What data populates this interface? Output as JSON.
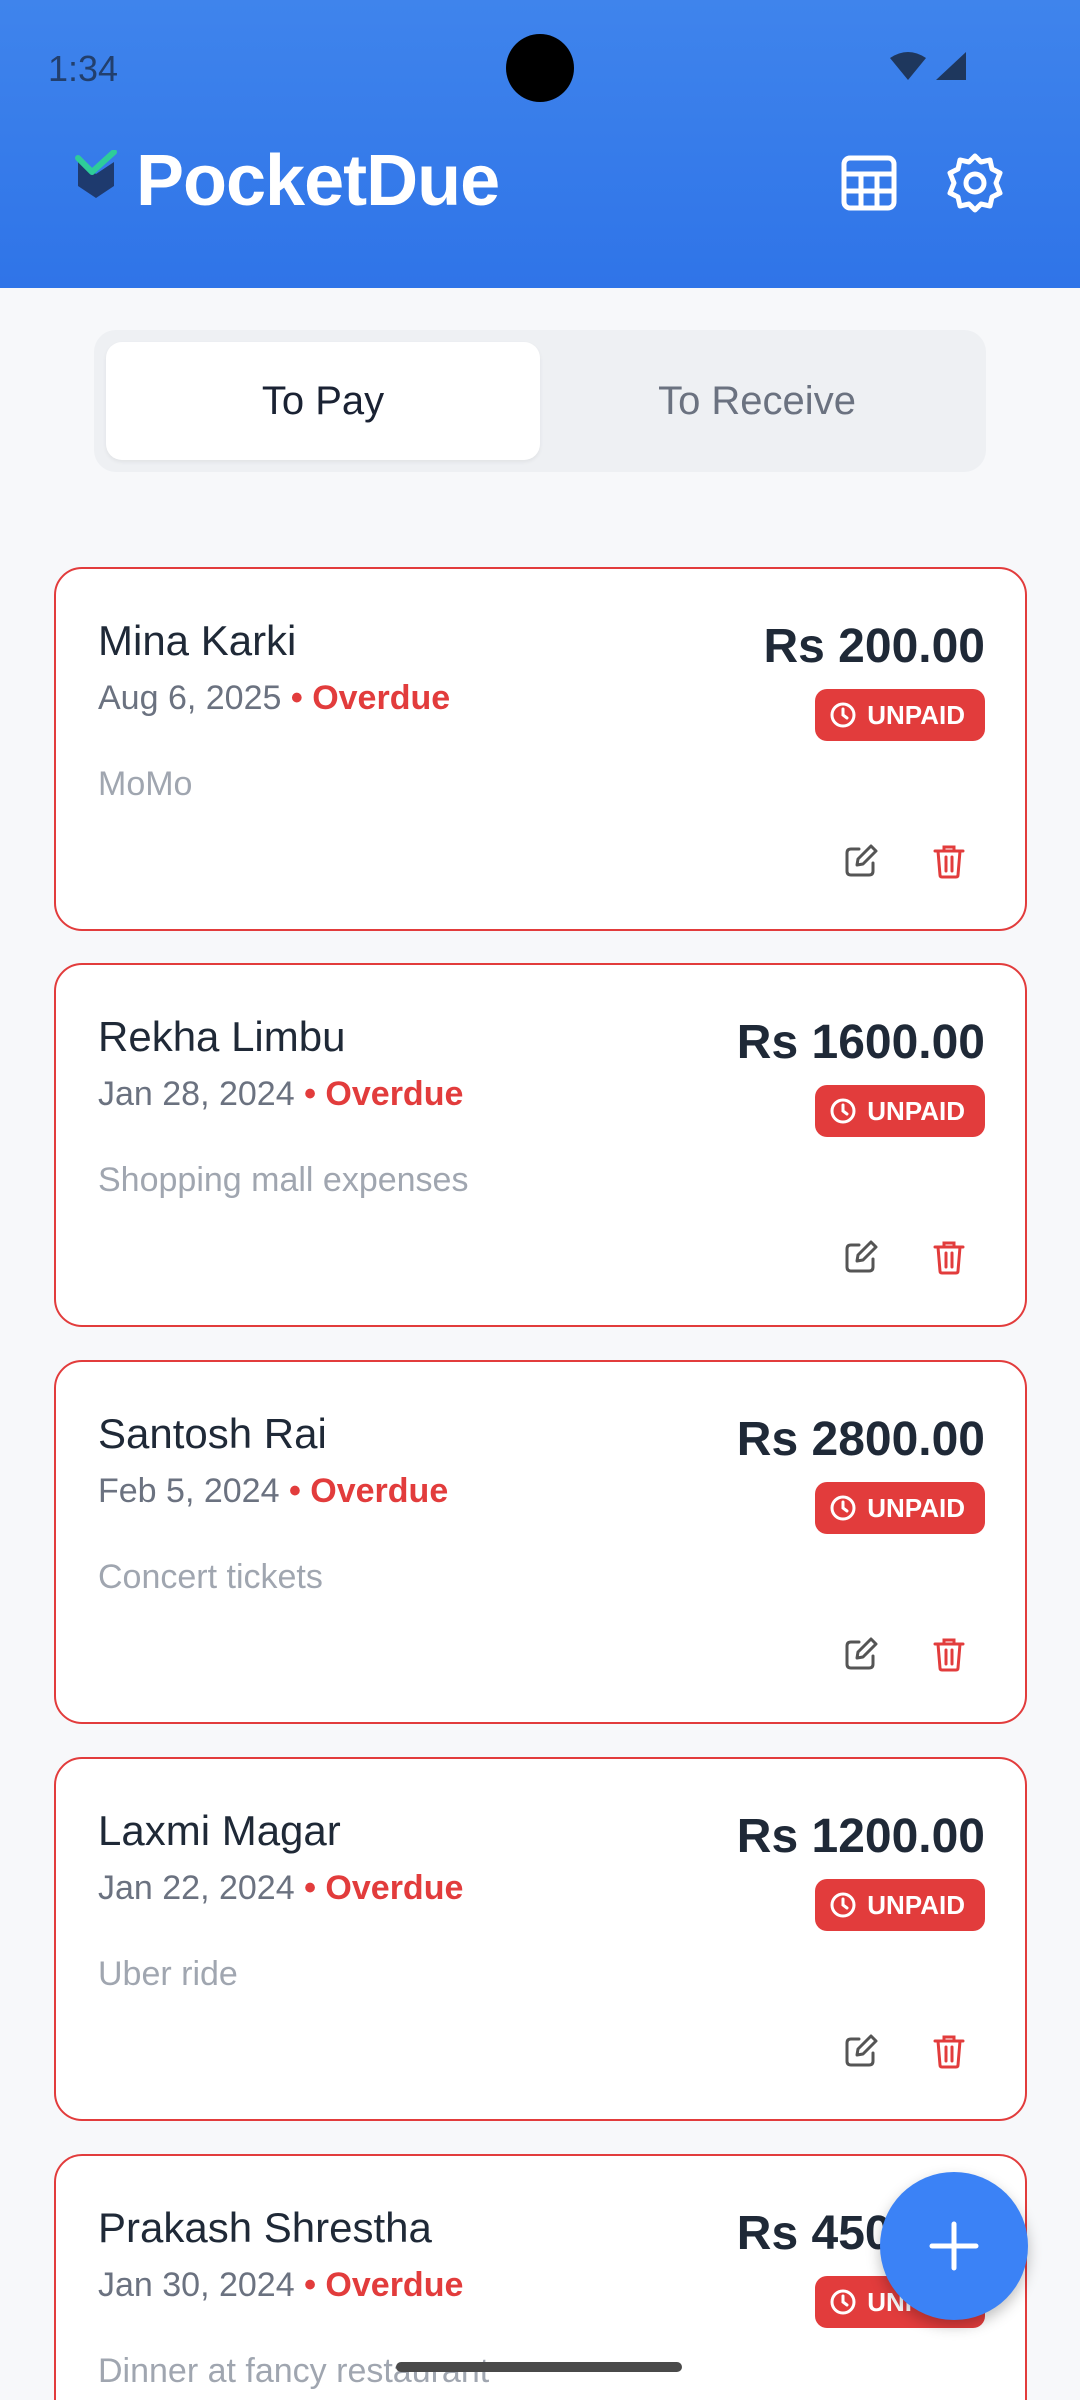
{
  "status": {
    "time": "1:34"
  },
  "app": {
    "title": "PocketDue"
  },
  "tabs": [
    {
      "label": "To Pay",
      "active": true
    },
    {
      "label": "To Receive",
      "active": false
    }
  ],
  "colors": {
    "primary": "#3b82f6",
    "overdue": "#e23c3c",
    "header": "#3f84ec"
  },
  "dues": [
    {
      "name": "Mina Karki",
      "date": "Aug 6, 2025",
      "status": "• Overdue",
      "amount": "Rs 200.00",
      "badge": "UNPAID",
      "note": "MoMo"
    },
    {
      "name": "Rekha Limbu",
      "date": "Jan 28, 2024",
      "status": "• Overdue",
      "amount": "Rs 1600.00",
      "badge": "UNPAID",
      "note": "Shopping mall expenses"
    },
    {
      "name": "Santosh Rai",
      "date": "Feb 5, 2024",
      "status": "• Overdue",
      "amount": "Rs 2800.00",
      "badge": "UNPAID",
      "note": "Concert tickets"
    },
    {
      "name": "Laxmi Magar",
      "date": "Jan 22, 2024",
      "status": "• Overdue",
      "amount": "Rs 1200.00",
      "badge": "UNPAID",
      "note": "Uber ride"
    },
    {
      "name": "Prakash Shrestha",
      "date": "Jan 30, 2024",
      "status": "• Overdue",
      "amount": "Rs 4500.00",
      "badge": "UNPAID",
      "note": "Dinner at fancy restaurant"
    }
  ],
  "icons": {
    "logo": "check-shield-icon",
    "table": "table-icon",
    "settings": "gear-icon",
    "edit": "edit-icon",
    "delete": "trash-icon",
    "fab": "plus-icon",
    "badge": "clock-icon"
  }
}
